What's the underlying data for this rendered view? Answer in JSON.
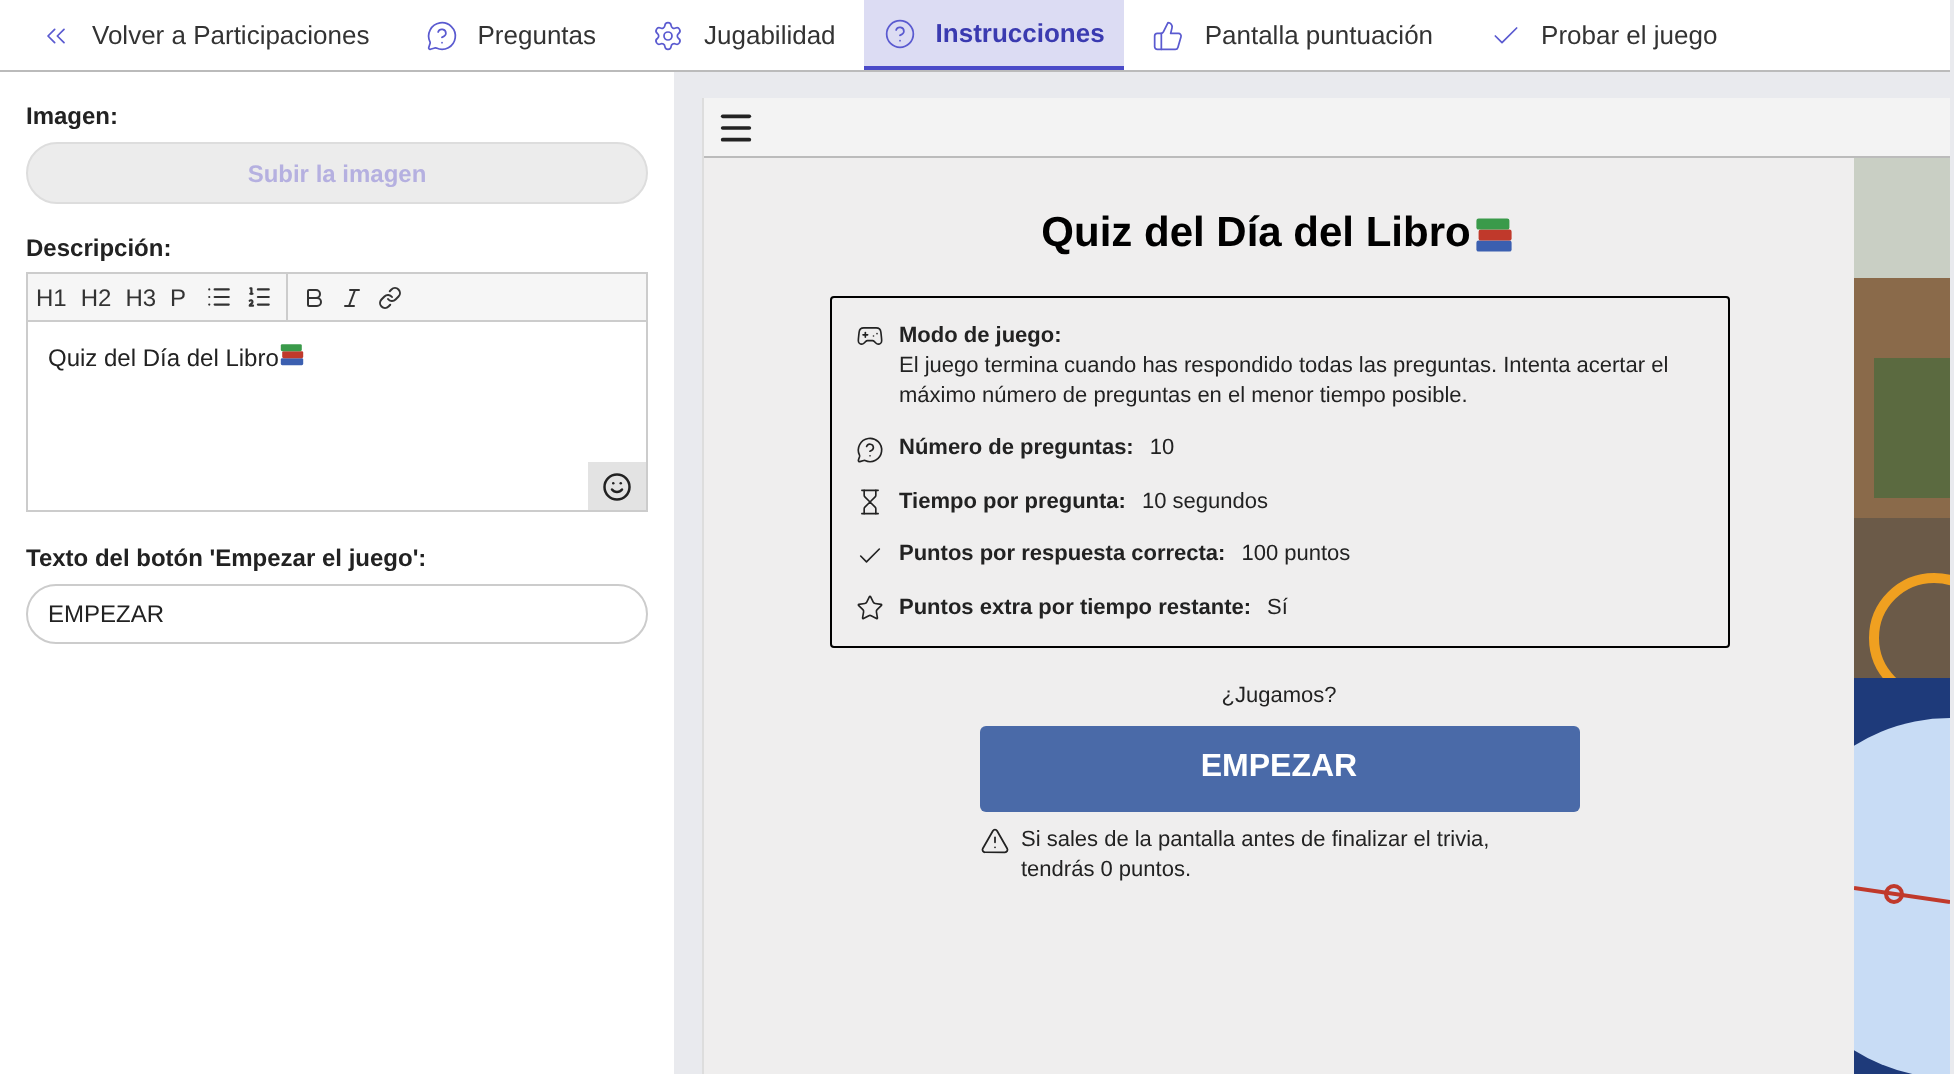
{
  "tabs": [
    {
      "label": "Volver a Participaciones",
      "selected": false
    },
    {
      "label": "Preguntas",
      "selected": false
    },
    {
      "label": "Jugabilidad",
      "selected": false
    },
    {
      "label": "Instrucciones",
      "selected": true
    },
    {
      "label": "Pantalla puntuación",
      "selected": false
    },
    {
      "label": "Probar el juego",
      "selected": false
    }
  ],
  "editor": {
    "image_label": "Imagen:",
    "upload_button": "Subir la imagen",
    "description_label": "Descripción:",
    "toolbar": [
      "H1",
      "H2",
      "H3",
      "P"
    ],
    "description_value": "Quiz del Día del Libro",
    "button_text_label": "Texto del botón 'Empezar el juego':",
    "button_text_value": "EMPEZAR"
  },
  "preview": {
    "title": "Quiz del Día del Libro",
    "rules": [
      {
        "label": "Modo de juego:",
        "value": "El juego termina cuando has respondido todas las preguntas. Intenta acertar el máximo número de preguntas en el menor tiempo posible.",
        "kind": "block"
      },
      {
        "label": "Número de preguntas:",
        "value": "10",
        "kind": "inline"
      },
      {
        "label": "Tiempo por pregunta:",
        "value": "10 segundos",
        "kind": "inline"
      },
      {
        "label": "Puntos por respuesta correcta:",
        "value": "100 puntos",
        "kind": "inline"
      },
      {
        "label": "Puntos extra por tiempo restante:",
        "value": "Sí",
        "kind": "inline"
      }
    ],
    "prompt": "¿Jugamos?",
    "start_button": "EMPEZAR",
    "warning": "Si sales de la pantalla antes de finalizar el trivia, tendrás 0 puntos."
  }
}
